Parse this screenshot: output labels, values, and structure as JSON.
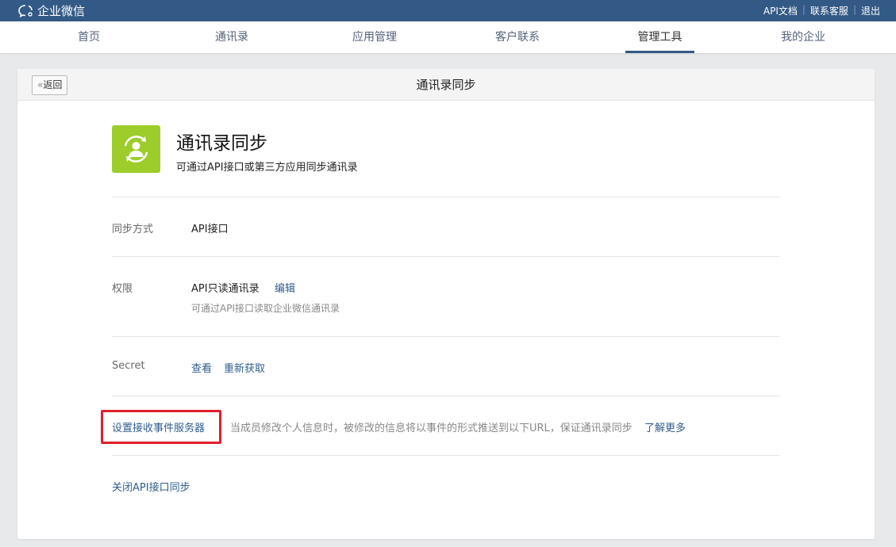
{
  "topbar": {
    "logo": "企业微信",
    "links": [
      "API文档",
      "联系客服",
      "退出"
    ]
  },
  "nav": {
    "tabs": [
      "首页",
      "通讯录",
      "应用管理",
      "客户联系",
      "管理工具",
      "我的企业"
    ],
    "active": "管理工具"
  },
  "card": {
    "back_label": "返回",
    "title": "通讯录同步",
    "app": {
      "title": "通讯录同步",
      "desc": "可通过API接口或第三方应用同步通讯录",
      "color": "#9ccd2a"
    },
    "sync_method": {
      "label": "同步方式",
      "value": "API接口"
    },
    "permission": {
      "label": "权限",
      "value": "API只读通讯录",
      "edit": "编辑",
      "note": "可通过API接口读取企业微信通讯录"
    },
    "secret": {
      "label": "Secret",
      "view": "查看",
      "refresh": "重新获取"
    },
    "event": {
      "label": "设置接收事件服务器",
      "desc": "当成员修改个人信息时，被修改的信息将以事件的形式推送到以下URL，保证通讯录同步",
      "more": "了解更多"
    },
    "close_link": "关闭API接口同步"
  }
}
